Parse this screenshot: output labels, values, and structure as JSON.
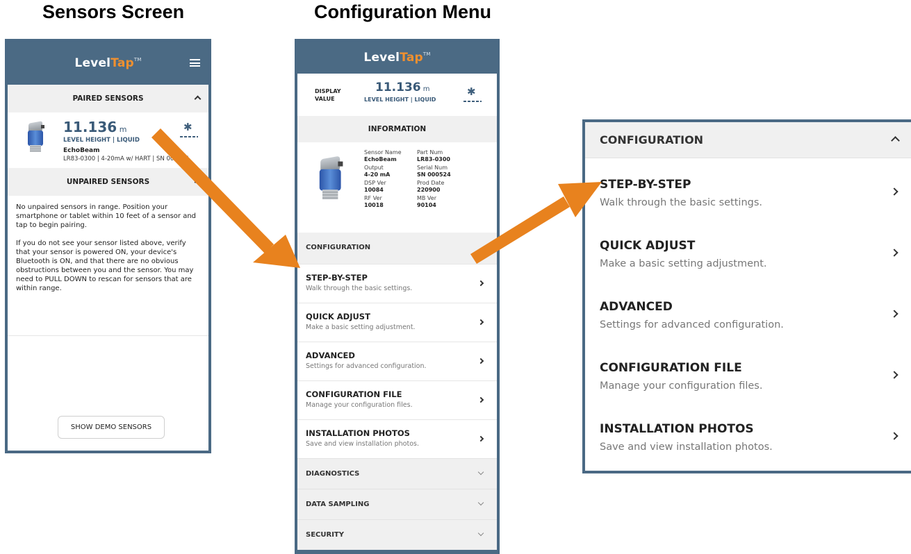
{
  "headings": {
    "left": "Sensors Screen",
    "middle": "Configuration Menu"
  },
  "app": {
    "logo_level": "Level",
    "logo_tap": "Tap",
    "logo_tm": "TM"
  },
  "sensors_screen": {
    "paired_header": "PAIRED SENSORS",
    "sensor": {
      "value": "11.136",
      "unit": "m",
      "label": "LEVEL HEIGHT | LIQUID",
      "name": "EchoBeam",
      "details": "LR83-0300 | 4-20mA w/ HART | SN 000524"
    },
    "unpaired_header": "UNPAIRED SENSORS",
    "unpaired_text_1": "No unpaired sensors in range. Position your smartphone or tablet within 10 feet of a sensor and tap to begin pairing.",
    "unpaired_text_2": "If you do not see your sensor listed above, verify that your sensor is powered ON, your device's Bluetooth is ON, and that there are no obvious obstructions between you and the sensor. You may need to PULL DOWN to rescan for sensors that are within range.",
    "demo_button": "SHOW DEMO SENSORS"
  },
  "config_screen": {
    "display_label_1": "DISPLAY",
    "display_label_2": "VALUE",
    "value": "11.136",
    "unit": "m",
    "value_label": "LEVEL HEIGHT | LIQUID",
    "information_header": "INFORMATION",
    "info_fields": [
      {
        "label": "Sensor Name",
        "value": "EchoBeam"
      },
      {
        "label": "Part Num",
        "value": "LR83-0300"
      },
      {
        "label": "Output",
        "value": "4-20 mA"
      },
      {
        "label": "Serial Num",
        "value": "SN 000524"
      },
      {
        "label": "DSP Ver",
        "value": "10084"
      },
      {
        "label": "Prod Date",
        "value": "220900"
      },
      {
        "label": "RF Ver",
        "value": "10018"
      },
      {
        "label": "MB Ver",
        "value": "90104"
      }
    ],
    "configuration_header": "CONFIGURATION",
    "collapsed_sections": [
      "DIAGNOSTICS",
      "DATA SAMPLING",
      "SECURITY"
    ]
  },
  "config_menu": {
    "header": "CONFIGURATION",
    "items": [
      {
        "title": "STEP-BY-STEP",
        "subtitle": "Walk through the basic settings."
      },
      {
        "title": "QUICK ADJUST",
        "subtitle": "Make a basic setting adjustment."
      },
      {
        "title": "ADVANCED",
        "subtitle": "Settings for advanced configuration."
      },
      {
        "title": "CONFIGURATION FILE",
        "subtitle": "Manage your configuration files."
      },
      {
        "title": "INSTALLATION PHOTOS",
        "subtitle": "Save and view installation photos."
      }
    ]
  },
  "colors": {
    "app_bar": "#4b6a84",
    "accent_orange": "#e8821e",
    "frame_border": "#4a6984",
    "value_blue": "#3a5a78"
  },
  "icons": [
    "hamburger-icon",
    "bluetooth-icon",
    "caret-up-icon",
    "caret-down-icon",
    "chevron-right-icon",
    "sensor-image"
  ]
}
